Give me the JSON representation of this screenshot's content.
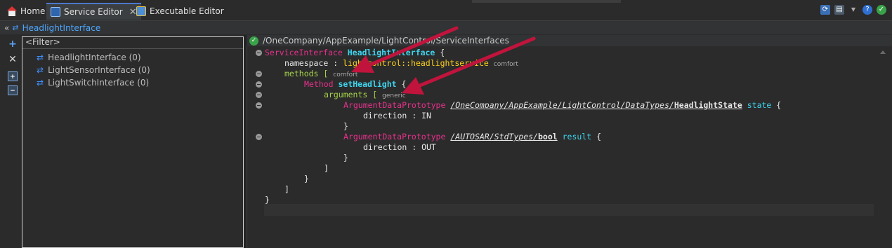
{
  "tabs": [
    {
      "label": "Home",
      "icon": "home-icon"
    },
    {
      "label": "Service Editor",
      "icon": "service-editor-icon",
      "active": true,
      "close": "✕"
    },
    {
      "label": "Executable Editor",
      "icon": "executable-editor-icon"
    }
  ],
  "breadcrumb": {
    "back": "«",
    "label": "HeadlightInterface"
  },
  "tree": {
    "filter_placeholder": "<Filter>",
    "items": [
      {
        "label": "HeadlightInterface (0)"
      },
      {
        "label": "LightSensorInterface (0)"
      },
      {
        "label": "LightSwitchInterface (0)"
      }
    ]
  },
  "editor": {
    "path": "/OneCompany/AppExample/LightControl/ServiceInterfaces",
    "code": {
      "l1_kw": "ServiceInterface",
      "l1_name": "HeadlightInterface",
      "l1_brace": " {",
      "l2_key": "namespace : ",
      "l2_val": "lightcontrol::headlightservice",
      "l2_hint": "comfort",
      "l3_key": "methods [",
      "l3_hint": "comfort",
      "l4_kw": "Method",
      "l4_name": "setHeadlight",
      "l4_brace": " {",
      "l5_key": "arguments [",
      "l5_hint": "generic",
      "l6_kw": "ArgumentDataPrototype",
      "l6_path_a": "/OneCompany/AppExample/LightControl/DataTypes/",
      "l6_path_b": "HeadlightState",
      "l6_name": "state",
      "l6_brace": " {",
      "l7": "direction : IN",
      "l8": "}",
      "l9_kw": "ArgumentDataPrototype",
      "l9_path_a": "/AUTOSAR/StdTypes/",
      "l9_path_b": "bool",
      "l9_name": "result",
      "l9_brace": " {",
      "l10": "direction : OUT",
      "l11": "}",
      "l12": "]",
      "l13": "}",
      "l14": "]",
      "l15": "}"
    }
  },
  "colors": {
    "keyword": "#e8308c",
    "identifier": "#3fd6f0",
    "property": "#a6d24a",
    "annotation_arrow": "#c0143c"
  }
}
